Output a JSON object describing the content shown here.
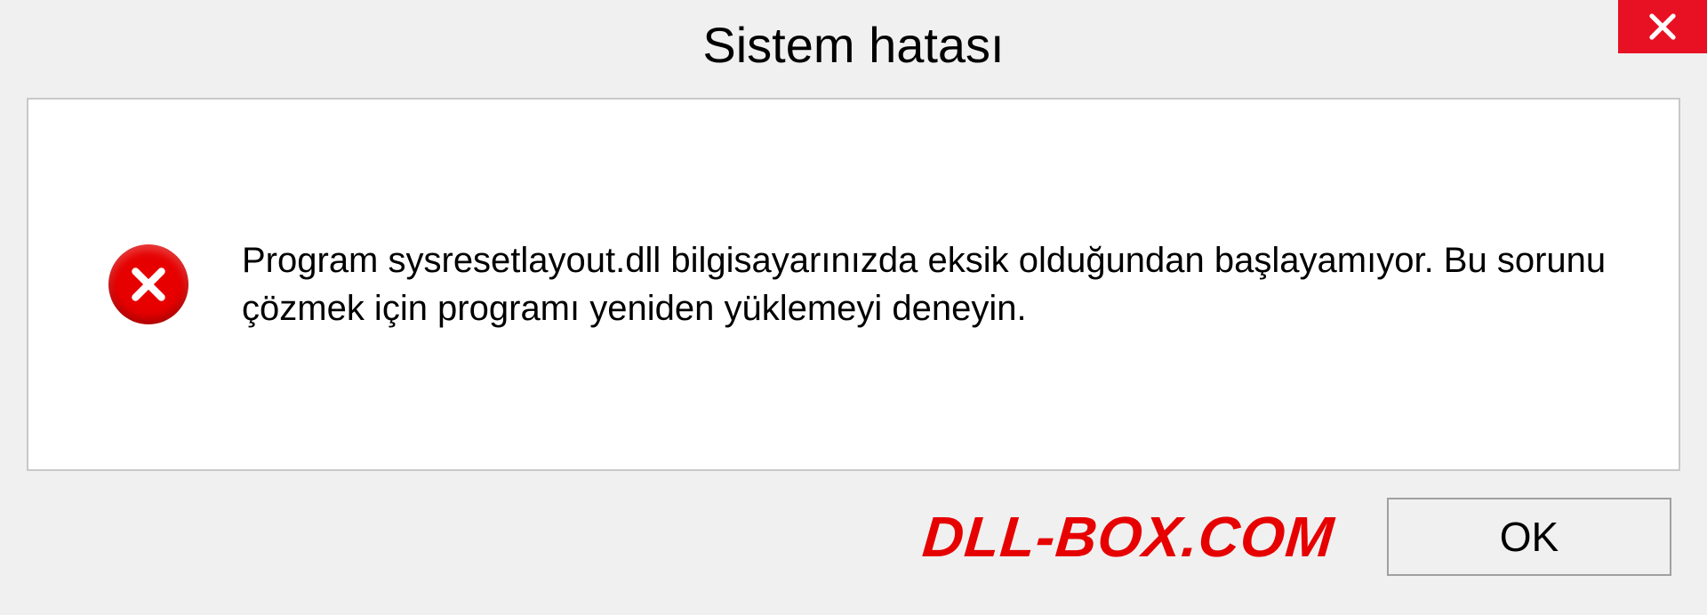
{
  "dialog": {
    "title": "Sistem hatası",
    "message": "Program sysresetlayout.dll bilgisayarınızda eksik olduğundan başlayamıyor. Bu sorunu çözmek için programı yeniden yüklemeyi deneyin.",
    "ok_label": "OK",
    "watermark": "DLL-BOX.COM"
  }
}
